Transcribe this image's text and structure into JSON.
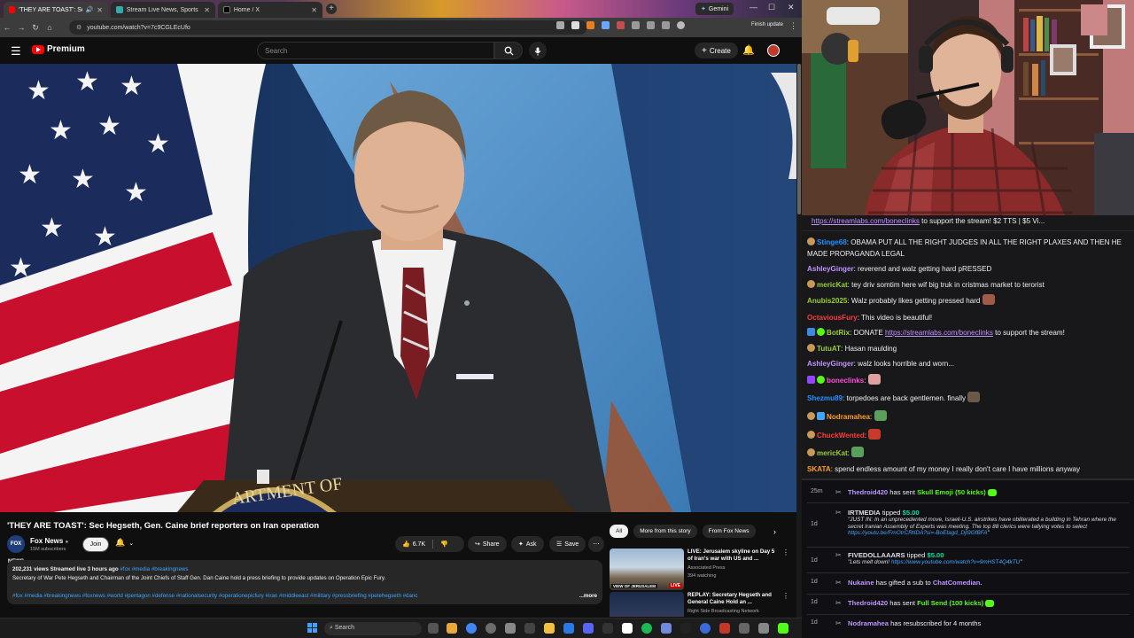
{
  "browser": {
    "tabs": [
      {
        "title": "'THEY ARE TOAST': Sec Heg",
        "active": true
      },
      {
        "title": "Stream Live News, Sports",
        "active": false
      },
      {
        "title": "Home / X",
        "active": false
      }
    ],
    "gemini_label": "Gemini",
    "url": "youtube.com/watch?v=7c9CGLEcUfo",
    "finish_update": "Finish update"
  },
  "youtube": {
    "brand": "Premium",
    "search_placeholder": "Search",
    "create_label": "Create",
    "video_title": "'THEY ARE TOAST': Sec Hegseth, Gen. Caine brief reporters on Iran operation",
    "channel": {
      "name": "Fox News",
      "subscribers": "15M subscribers",
      "logo_text": "FOX NEWS",
      "join_label": "Join"
    },
    "actions": {
      "likes": "6.7K",
      "share": "Share",
      "ask": "Ask",
      "save": "Save"
    },
    "description": {
      "meta": "202,231 views  Streamed live 3 hours ago",
      "meta_tags": "#fox #media #breakingnews",
      "text": "Secretary of War Pete Hegseth and Chairman of the Joint Chiefs of Staff Gen. Dan Caine hold a press briefing to provide updates on Operation Epic Fury.",
      "tags": "#fox #media #breakingnews #foxnews #world #pentagon #defense #nationalsecurity #operationepicfury #iran #middleeast #military #pressbriefing #petehegseth #danc",
      "more": "...more"
    },
    "chips": [
      "All",
      "More from this story",
      "From Fox News"
    ],
    "recommendations": [
      {
        "title": "LIVE: Jerusalem skyline on Day 5 of Iran's war with US and ...",
        "channel": "Associated Press",
        "meta": "394 watching",
        "badge": "LIVE",
        "overlay": "VIEW OF JERUSALEM"
      },
      {
        "title": "REPLAY: Secretary Hegseth and General Caine Hold an ...",
        "channel": "Right Side Broadcasting Network",
        "meta": "",
        "badge": "",
        "overlay": ""
      }
    ]
  },
  "taskbar": {
    "search_placeholder": "Search"
  },
  "chat": {
    "pinned_link": "https://streamlabs.com/boneclinks",
    "pinned_rest": " to support the stream! $2 TTS | $5 Vi...",
    "messages": [
      {
        "user": "Stinge68",
        "color": "#1e90ff",
        "text": " OBAMA PUT ALL THE RIGHT JUDGES IN ALL THE RIGHT PLAXES AND THEN HE MADE PROPAGANDA LEGAL"
      },
      {
        "user": "AshleyGinger",
        "color": "#bf94ff",
        "text": " reverend and walz getting hard pRESSED"
      },
      {
        "user": "mericKat",
        "color": "#9acd32",
        "text": " tey driv somtim here wif big truk in cristmas market to terorist"
      },
      {
        "user": "Anubis2025",
        "color": "#9acd32",
        "text": " Walz probably likes getting pressed hard"
      },
      {
        "user": "OctaviousFury",
        "color": "#ff3b3b",
        "text": " This video is beautiful!"
      },
      {
        "user": "BotRix",
        "color": "#9acd32",
        "text": " DONATE ",
        "link": "https://streamlabs.com/boneclinks",
        "after": " to support the stream!"
      },
      {
        "user": "TutuAT",
        "color": "#9acd32",
        "text": " Hasan maulding"
      },
      {
        "user": "AshleyGinger",
        "color": "#bf94ff",
        "text": " walz looks horrible and worn..."
      },
      {
        "user": "boneclinks",
        "color": "#ff4fd8",
        "text": " "
      },
      {
        "user": "Shezmu89",
        "color": "#1e90ff",
        "text": " torpedoes are back gentlemen. finally"
      },
      {
        "user": "Nodramahea",
        "color": "#ff9f1a",
        "text": " "
      },
      {
        "user": "ChuckWented",
        "color": "#ff3b3b",
        "text": " "
      },
      {
        "user": "mericKat",
        "color": "#9acd32",
        "text": " "
      },
      {
        "user": "SKATA",
        "color": "#ff9f1a",
        "text": " spend endless amount of my money I really don't care I have millions anyway"
      }
    ]
  },
  "feed": [
    {
      "time": "25m",
      "user": "Thedroid420",
      "text": " has sent ",
      "item": "Skull Emoji (50 kicks)",
      "color": "#53fc18"
    },
    {
      "time": "1d",
      "user": "IRTMEDIA",
      "text": " tipped ",
      "amount": "$5.00",
      "quote": "\"JUST IN: In an unprecedented move, Israeli-U.S. airstrikes have obliterated a building in Tehran where the secret Iranian Assembly of Experts was meeting. The top 88 clerics were tallying votes to select ",
      "quote_link": "https://youtu.be/FmOtrCRtIDA?si=-BoEtagd_DjI9GfBFA",
      "quote_end": "\""
    },
    {
      "time": "1d",
      "user": "FIVEDOLLAAARS",
      "text": " tipped ",
      "amount": "$5.00",
      "quote": "\"Lets melt down! ",
      "quote_link": "https://www.youtube.com/watch?v=9mHST4Q4kTU",
      "quote_end": "\""
    },
    {
      "time": "1d",
      "user": "Nukaine",
      "text": " has gifted a sub to ",
      "target": "ChatComedian."
    },
    {
      "time": "1d",
      "user": "Thedroid420",
      "text": " has sent ",
      "item": "Full Send (100 kicks)",
      "color": "#53fc18"
    },
    {
      "time": "1d",
      "user": "Nodramahea",
      "text": " has resubscribed for 4 months"
    }
  ]
}
